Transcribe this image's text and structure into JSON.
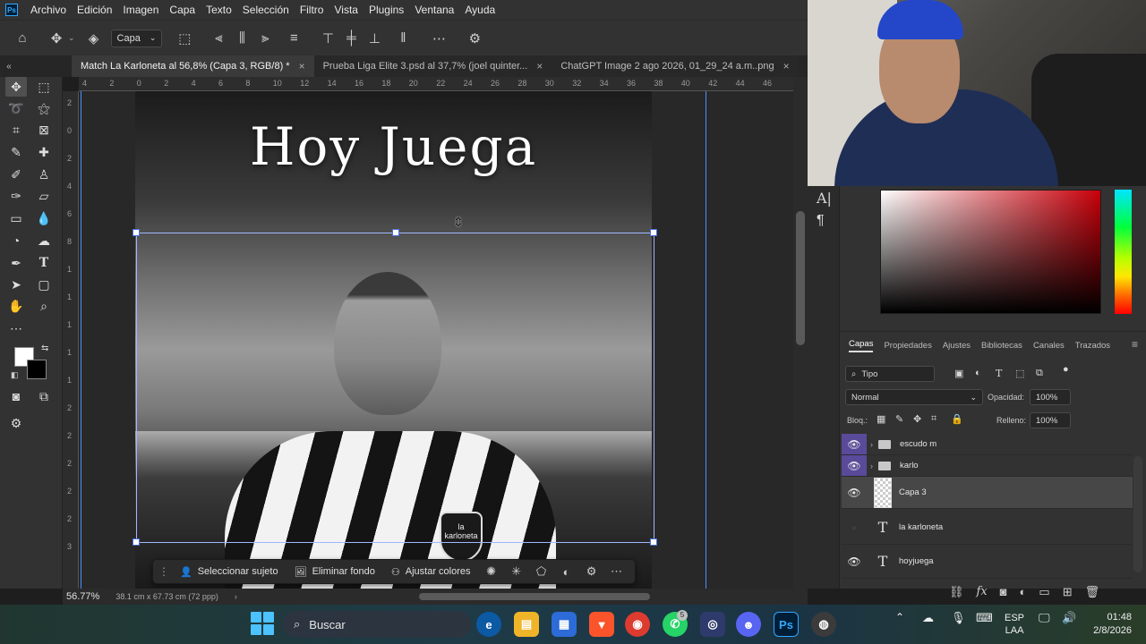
{
  "app": {
    "logo": "Ps"
  },
  "menu": [
    "Archivo",
    "Edición",
    "Imagen",
    "Capa",
    "Texto",
    "Selección",
    "Filtro",
    "Vista",
    "Plugins",
    "Ventana",
    "Ayuda"
  ],
  "options": {
    "select_target": "Capa"
  },
  "tabs": [
    {
      "label": "Match La Karloneta al 56,8% (Capa 3, RGB/8) *",
      "active": true
    },
    {
      "label": "Prueba Liga Elite 3.psd al 37,7% (joel quinter...",
      "active": false
    },
    {
      "label": "ChatGPT Image 2 ago 2026, 01_29_24 a.m..png",
      "active": false
    }
  ],
  "rulers": {
    "top": [
      "4",
      "2",
      "0",
      "2",
      "4",
      "6",
      "8",
      "10",
      "12",
      "14",
      "16",
      "18",
      "20",
      "22",
      "24",
      "26",
      "28",
      "30",
      "32",
      "34",
      "36",
      "38",
      "40",
      "42",
      "44",
      "46"
    ],
    "left": [
      "2",
      "0",
      "2",
      "4",
      "6",
      "8",
      "1",
      "1",
      "1",
      "1",
      "1",
      "2",
      "2",
      "2",
      "2",
      "2",
      "3"
    ]
  },
  "canvas": {
    "title_text": "Hoy Juega",
    "crest_text": "la karloneta"
  },
  "context_bar": {
    "select_subject": "Seleccionar sujeto",
    "remove_bg": "Eliminar fondo",
    "adjust_colors": "Ajustar colores"
  },
  "status": {
    "zoom": "56.77%",
    "doc_size": "38.1 cm x 67.73 cm (72 ppp)"
  },
  "layers_panel": {
    "tabs": [
      "Capas",
      "Propiedades",
      "Ajustes",
      "Bibliotecas",
      "Canales",
      "Trazados"
    ],
    "filter": "Tipo",
    "blend_mode": "Normal",
    "opacity_label": "Opacidad:",
    "opacity_value": "100%",
    "lock_label": "Bloq.:",
    "fill_label": "Relleno:",
    "fill_value": "100%",
    "layers": [
      {
        "name": "escudo m",
        "type": "group",
        "visible": true
      },
      {
        "name": "karlo",
        "type": "group",
        "visible": true
      },
      {
        "name": "Capa 3",
        "type": "pixel",
        "visible": true,
        "selected": true
      },
      {
        "name": "la karloneta",
        "type": "text",
        "visible": false
      },
      {
        "name": "hoyjuega",
        "type": "text",
        "visible": true
      }
    ]
  },
  "taskbar": {
    "search_placeholder": "Buscar",
    "lang_top": "ESP",
    "lang_bottom": "LAA",
    "time": "01:48",
    "date": "2/8/2026",
    "whatsapp_badge": "5"
  },
  "colors": {
    "accent": "#31a8ff",
    "guide": "#4a90ff",
    "layer_group_highlight": "#5a4a9a",
    "foreground": "#ffffff",
    "background": "#000000"
  }
}
